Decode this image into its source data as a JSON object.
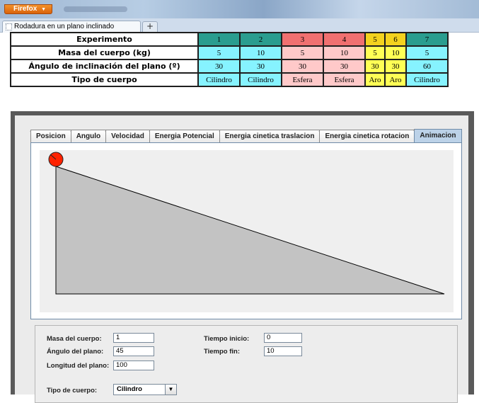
{
  "browser": {
    "menu_label": "Firefox",
    "menu_arrow": "▼",
    "tab_title": "Rodadura en un plano inclinado",
    "new_tab_symbol": "+"
  },
  "table": {
    "rows": [
      {
        "header": "Experimento",
        "cells": [
          "1",
          "2",
          "3",
          "4",
          "5",
          "6",
          "7"
        ]
      },
      {
        "header": "Masa del cuerpo (kg)",
        "cells": [
          "5",
          "10",
          "5",
          "10",
          "5",
          "10",
          "5"
        ]
      },
      {
        "header": "Ángulo de inclinación del plano (º)",
        "cells": [
          "30",
          "30",
          "30",
          "30",
          "30",
          "30",
          "60"
        ]
      },
      {
        "header": "Tipo de cuerpo",
        "cells": [
          "Cilindro",
          "Cilindro",
          "Esfera",
          "Esfera",
          "Aro",
          "Aro",
          "Cilindro"
        ]
      }
    ],
    "colors": {
      "teal": "#2a9d8f",
      "red": "#f07070",
      "yellow": "#f3d21e",
      "cyan": "#86f3ff",
      "pink": "#ffc9c9",
      "light_yellow": "#ffff55"
    }
  },
  "applet": {
    "tabs": [
      "Posicion",
      "Angulo",
      "Velocidad",
      "Energia Potencial",
      "Energia cinetica traslacion",
      "Energia cinetica rotacion",
      "Animacion"
    ],
    "active_tab": "Animacion",
    "canvas": {
      "ramp_color": "#c3c3c3",
      "ball_color": "#ff2200"
    },
    "form": {
      "mass_label": "Masa del cuerpo:",
      "mass_value": "1",
      "angle_label": "Ángulo del plano:",
      "angle_value": "45",
      "length_label": "Longitud del plano:",
      "length_value": "100",
      "start_label": "Tiempo inicio:",
      "start_value": "0",
      "end_label": "Tiempo fin:",
      "end_value": "10",
      "body_label": "Tipo de cuerpo:",
      "body_value": "Cilindro"
    }
  }
}
